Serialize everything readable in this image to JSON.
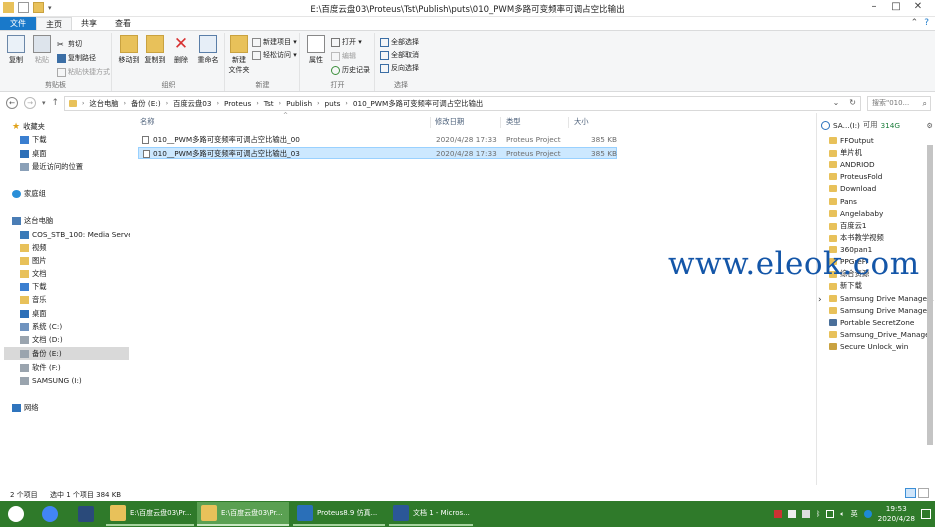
{
  "window": {
    "title": "E:\\百度云盘03\\Proteus\\Tst\\Publish\\puts\\010_PWM多路可变频率可调占空比输出",
    "controls": [
      "–",
      "□",
      "✕"
    ]
  },
  "ribbon": {
    "tabs": [
      "文件",
      "主页",
      "共享",
      "查看"
    ],
    "active_tab": "主页",
    "clipboard": {
      "copy": "复制",
      "paste": "粘贴",
      "cut": "剪切",
      "copy_path": "复制路径",
      "paste_shortcut": "粘贴快捷方式",
      "group": "剪贴板"
    },
    "organize": {
      "move_to": "移动到",
      "copy_to": "复制到",
      "delete": "删除",
      "rename": "重命名",
      "group": "组织"
    },
    "new": {
      "new_folder": "新建\n文件夹",
      "new_item": "新建项目 ▾",
      "easy_access": "轻松访问 ▾",
      "group": "新建"
    },
    "open": {
      "properties": "属性",
      "open": "打开 ▾",
      "edit": "编辑",
      "history": "历史记录",
      "group": "打开"
    },
    "select": {
      "select_all": "全部选择",
      "select_none": "全部取消",
      "invert": "反向选择",
      "group": "选择"
    }
  },
  "address": {
    "crumbs": [
      "这台电脑",
      "备份 (E:)",
      "百度云盘03",
      "Proteus",
      "Tst",
      "Publish",
      "puts",
      "010_PWM多路可变频率可调占空比输出"
    ],
    "search_placeholder": "搜索\"010..."
  },
  "navpane": {
    "favorites_header": "收藏夹",
    "favorites": [
      "下载",
      "桌面",
      "最近访问的位置"
    ],
    "homegroup": "家庭组",
    "thispc": "这台电脑",
    "pc_items": [
      "COS_STB_100: Media Server",
      "视频",
      "图片",
      "文档",
      "下载",
      "音乐",
      "桌面",
      "系统 (C:)",
      "文档 (D:)",
      "备份 (E:)",
      "软件 (F:)",
      "SAMSUNG (I:)"
    ],
    "network": "网络"
  },
  "filelist": {
    "columns": [
      "名称",
      "修改日期",
      "类型",
      "大小"
    ],
    "rows": [
      {
        "name": "010__PWM多路可变频率可调占空比输出_00",
        "date": "2020/4/28 17:33",
        "type": "Proteus Project",
        "size": "385 KB",
        "selected": false
      },
      {
        "name": "010__PWM多路可变频率可调占空比输出_03",
        "date": "2020/4/28 17:33",
        "type": "Proteus Project",
        "size": "385 KB",
        "selected": true
      }
    ]
  },
  "rightpane": {
    "drive_label": "SA...(I:)",
    "free_label": "可用",
    "free_value": "314G",
    "items": [
      "FFOutput",
      "单片机",
      "ANDRIOD",
      "ProteusFold",
      "Download",
      "Pans",
      "Angelababy",
      "百度云1",
      "本书教学视频",
      "360pan1",
      "PPGreFi",
      "综合资源",
      "新下载",
      "Samsung Drive Manage...",
      "Samsung Drive Manager",
      "Portable SecretZone",
      "Samsung_Drive_Manager",
      "Secure Unlock_win"
    ]
  },
  "watermark": "www.eleok.com",
  "statusbar": {
    "count": "2 个项目",
    "selected": "选中 1 个项目 384 KB"
  },
  "taskbar": {
    "items": [
      {
        "label": "E:\\百度云盘03\\Pr...",
        "state": "open"
      },
      {
        "label": "E:\\百度云盘03\\Pr...",
        "state": "active"
      },
      {
        "label": "Proteus8.9 仿真...",
        "state": "open"
      },
      {
        "label": "文档 1 - Micros...",
        "state": "open"
      }
    ],
    "ime": "英",
    "time": "19:53",
    "date": "2020/4/28"
  },
  "colors": {
    "file_tab": "#1979ca",
    "selection": "#cce8ff",
    "taskbar": "#2f7a2a",
    "watermark": "#1456a8",
    "folder": "#e8c15a"
  }
}
